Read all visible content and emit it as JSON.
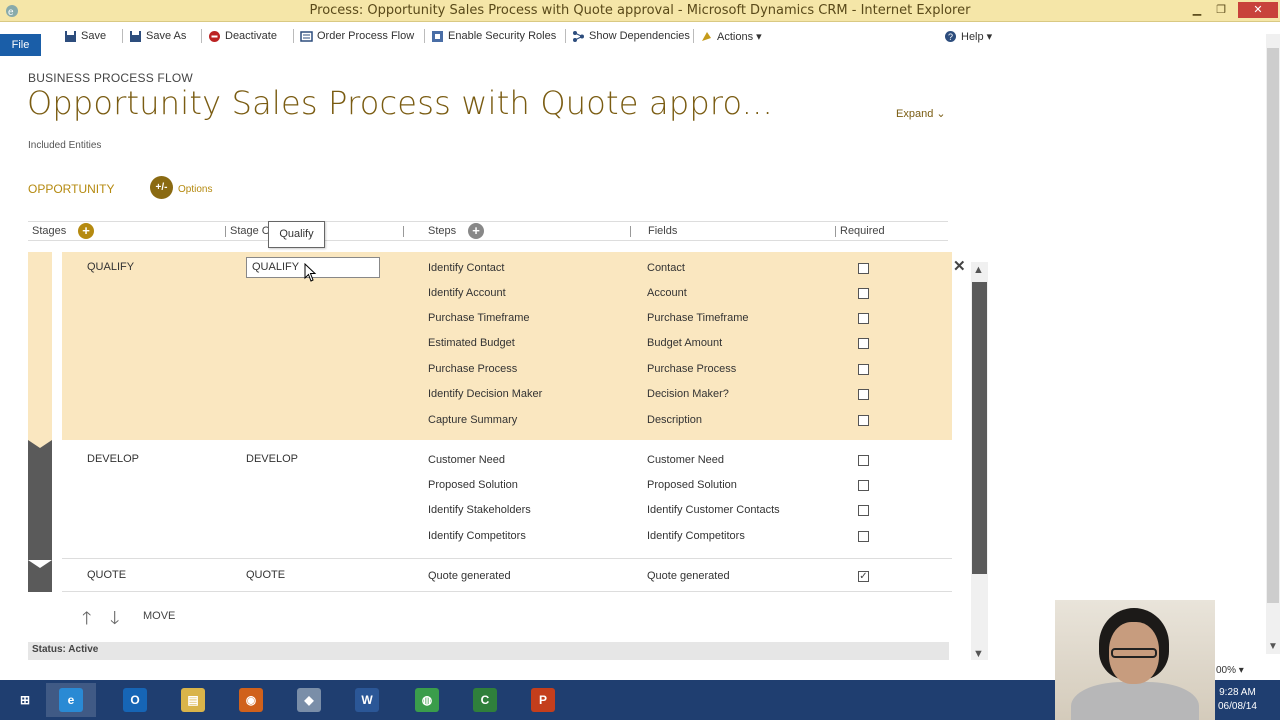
{
  "window": {
    "title": "Process: Opportunity Sales Process with Quote approval - Microsoft Dynamics CRM - Internet Explorer",
    "minimize": "▁",
    "restore": "❐",
    "close": "✕"
  },
  "commandbar": {
    "file": "File",
    "items": [
      {
        "label": "Save",
        "icon": "save-icon"
      },
      {
        "label": "Save As",
        "icon": "save-as-icon"
      },
      {
        "label": "Deactivate",
        "icon": "deactivate-icon"
      },
      {
        "label": "Order Process Flow",
        "icon": "order-icon"
      },
      {
        "label": "Enable Security Roles",
        "icon": "security-icon"
      },
      {
        "label": "Show Dependencies",
        "icon": "dependencies-icon"
      },
      {
        "label": "Actions ▾",
        "icon": "actions-icon"
      }
    ],
    "help": "Help ▾"
  },
  "header": {
    "type_label": "BUSINESS PROCESS FLOW",
    "title": "Opportunity Sales Process with Quote appro...",
    "expand": "Expand ⌄",
    "included_entities": "Included Entities",
    "entity": "OPPORTUNITY",
    "options": "Options",
    "options_icon_glyph": "+/-"
  },
  "columns": {
    "stages": "Stages",
    "stage_category": "Stage C",
    "steps": "Steps",
    "fields": "Fields",
    "required": "Required"
  },
  "tooltip": "Qualify",
  "stages": [
    {
      "name": "QUALIFY",
      "category": "QUALIFY",
      "active": true,
      "rows": [
        {
          "step": "Identify Contact",
          "field": "Contact",
          "required": false
        },
        {
          "step": "Identify Account",
          "field": "Account",
          "required": false
        },
        {
          "step": "Purchase Timeframe",
          "field": "Purchase Timeframe",
          "required": false
        },
        {
          "step": "Estimated Budget",
          "field": "Budget Amount",
          "required": false
        },
        {
          "step": "Purchase Process",
          "field": "Purchase Process",
          "required": false
        },
        {
          "step": "Identify Decision Maker",
          "field": "Decision Maker?",
          "required": false
        },
        {
          "step": "Capture Summary",
          "field": "Description",
          "required": false
        }
      ]
    },
    {
      "name": "DEVELOP",
      "category": "DEVELOP",
      "active": false,
      "rows": [
        {
          "step": "Customer Need",
          "field": "Customer Need",
          "required": false
        },
        {
          "step": "Proposed Solution",
          "field": "Proposed Solution",
          "required": false
        },
        {
          "step": "Identify Stakeholders",
          "field": "Identify Customer Contacts",
          "required": false
        },
        {
          "step": "Identify Competitors",
          "field": "Identify Competitors",
          "required": false
        }
      ]
    },
    {
      "name": "QUOTE",
      "category": "QUOTE",
      "active": false,
      "rows": [
        {
          "step": "Quote generated",
          "field": "Quote generated",
          "required": true
        }
      ]
    }
  ],
  "move": {
    "label": "MOVE",
    "up": "🡑",
    "down": "🡓"
  },
  "status": "Status: Active",
  "zoom": "00% ▾",
  "clock": {
    "time": "9:28 AM",
    "date": "06/08/14"
  },
  "colors": {
    "accent_gold": "#b58a10",
    "title_brown": "#7a5c12",
    "active_stage_bg": "#fae7c0",
    "titlebar_bg": "#f5e6a8",
    "file_blue": "#1a5ea8",
    "taskbar": "#1f3e70"
  },
  "taskbar_apps": [
    {
      "name": "start",
      "glyph": "⊞",
      "color": "#1f3e70"
    },
    {
      "name": "internet-explorer",
      "glyph": "e",
      "color": "#2a8ad4"
    },
    {
      "name": "outlook",
      "glyph": "O",
      "color": "#1665b5"
    },
    {
      "name": "file-explorer",
      "glyph": "▤",
      "color": "#d9b44a"
    },
    {
      "name": "firefox",
      "glyph": "◉",
      "color": "#d0611b"
    },
    {
      "name": "remote-app",
      "glyph": "◆",
      "color": "#7a8ea8"
    },
    {
      "name": "word",
      "glyph": "W",
      "color": "#2b5797"
    },
    {
      "name": "chrome",
      "glyph": "◍",
      "color": "#3a9d4b"
    },
    {
      "name": "camtasia",
      "glyph": "C",
      "color": "#2f7f3b"
    },
    {
      "name": "powerpoint",
      "glyph": "P",
      "color": "#c43e1c"
    }
  ]
}
